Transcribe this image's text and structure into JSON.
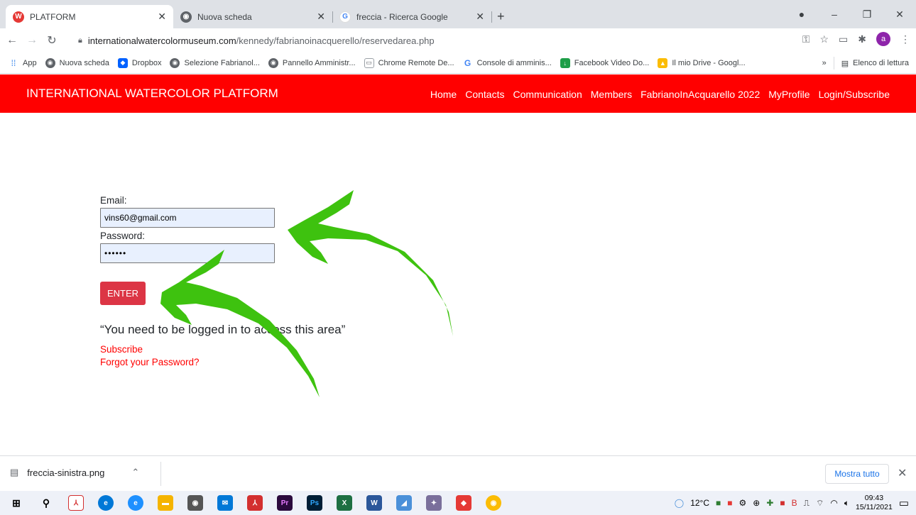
{
  "browser": {
    "tabs": [
      {
        "title": "PLATFORM",
        "active": true
      },
      {
        "title": "Nuova scheda",
        "active": false
      },
      {
        "title": "freccia - Ricerca Google",
        "active": false
      }
    ],
    "url_host": "internationalwatercolormuseum.com",
    "url_path": "/kennedy/fabrianoinacquerello/reservedarea.php",
    "profile_initial": "a",
    "bookmarks": [
      "App",
      "Nuova scheda",
      "Dropbox",
      "Selezione Fabrianol...",
      "Pannello Amministr...",
      "Chrome Remote De...",
      "Console di amminis...",
      "Facebook Video Do...",
      "Il mio Drive - Googl..."
    ],
    "reading_list": "Elenco di lettura",
    "more_bookmarks": "»"
  },
  "site": {
    "brand": "INTERNATIONAL WATERCOLOR PLATFORM",
    "menu": [
      "Home",
      "Contacts",
      "Communication",
      "Members",
      "FabrianoInAcquarello 2022",
      "MyProfile",
      "Login/Subscribe"
    ],
    "accent_color": "#ff0000"
  },
  "login": {
    "email_label": "Email:",
    "email_value": "vins60@gmail.com",
    "password_label": "Password:",
    "password_value": "••••••",
    "enter_label": "ENTER",
    "message": "“You need to be logged in to access this area”",
    "subscribe_link": "Subscribe",
    "forgot_link": "Forgot your Password?",
    "button_color": "#dc3545"
  },
  "downloads": {
    "file": "freccia-sinistra.png",
    "show_all": "Mostra tutto"
  },
  "taskbar": {
    "temperature": "12°C",
    "time": "09:43",
    "date": "15/11/2021"
  }
}
